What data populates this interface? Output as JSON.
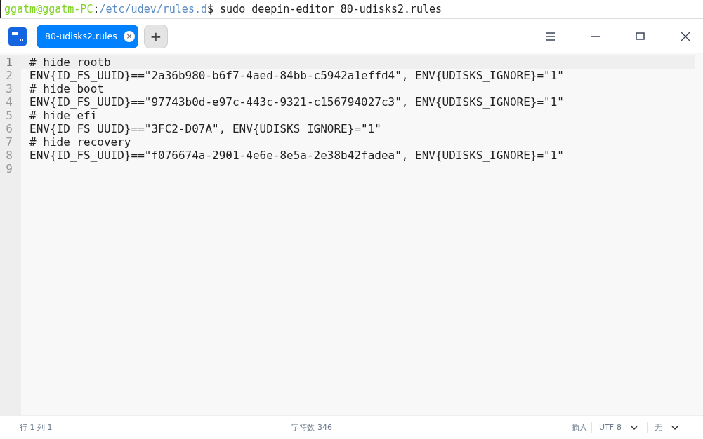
{
  "terminal": {
    "user_host": "ggatm@ggatm-PC",
    "separator": ":",
    "path": "/etc/udev/rules.d",
    "prompt": "$",
    "command": " sudo deepin-editor 80-udisks2.rules"
  },
  "tabs": [
    {
      "label": "80-udisks2.rules",
      "selected": true,
      "close": "×"
    }
  ],
  "new_tab": "+",
  "editor": {
    "lines": [
      {
        "number": "1",
        "text": "# hide rootb",
        "current": true
      },
      {
        "number": "2",
        "text": "ENV{ID_FS_UUID}==\"2a36b980-b6f7-4aed-84bb-c5942a1effd4\", ENV{UDISKS_IGNORE}=\"1\"",
        "current": false
      },
      {
        "number": "3",
        "text": "# hide boot",
        "current": false
      },
      {
        "number": "4",
        "text": "ENV{ID_FS_UUID}==\"97743b0d-e97c-443c-9321-c156794027c3\", ENV{UDISKS_IGNORE}=\"1\"",
        "current": false
      },
      {
        "number": "5",
        "text": "# hide efi",
        "current": false
      },
      {
        "number": "6",
        "text": "ENV{ID_FS_UUID}==\"3FC2-D07A\", ENV{UDISKS_IGNORE}=\"1\"",
        "current": false
      },
      {
        "number": "7",
        "text": "# hide recovery",
        "current": false
      },
      {
        "number": "8",
        "text": "ENV{ID_FS_UUID}==\"f076674a-2901-4e6e-8e5a-2e38b42fadea\", ENV{UDISKS_IGNORE}=\"1\"",
        "current": false
      },
      {
        "number": "9",
        "current": false
      }
    ]
  },
  "status_bar": {
    "position": "行 1  列 1",
    "char_count": "字符数 346",
    "mode": "插入",
    "encoding": "UTF-8",
    "highlight": "无"
  }
}
